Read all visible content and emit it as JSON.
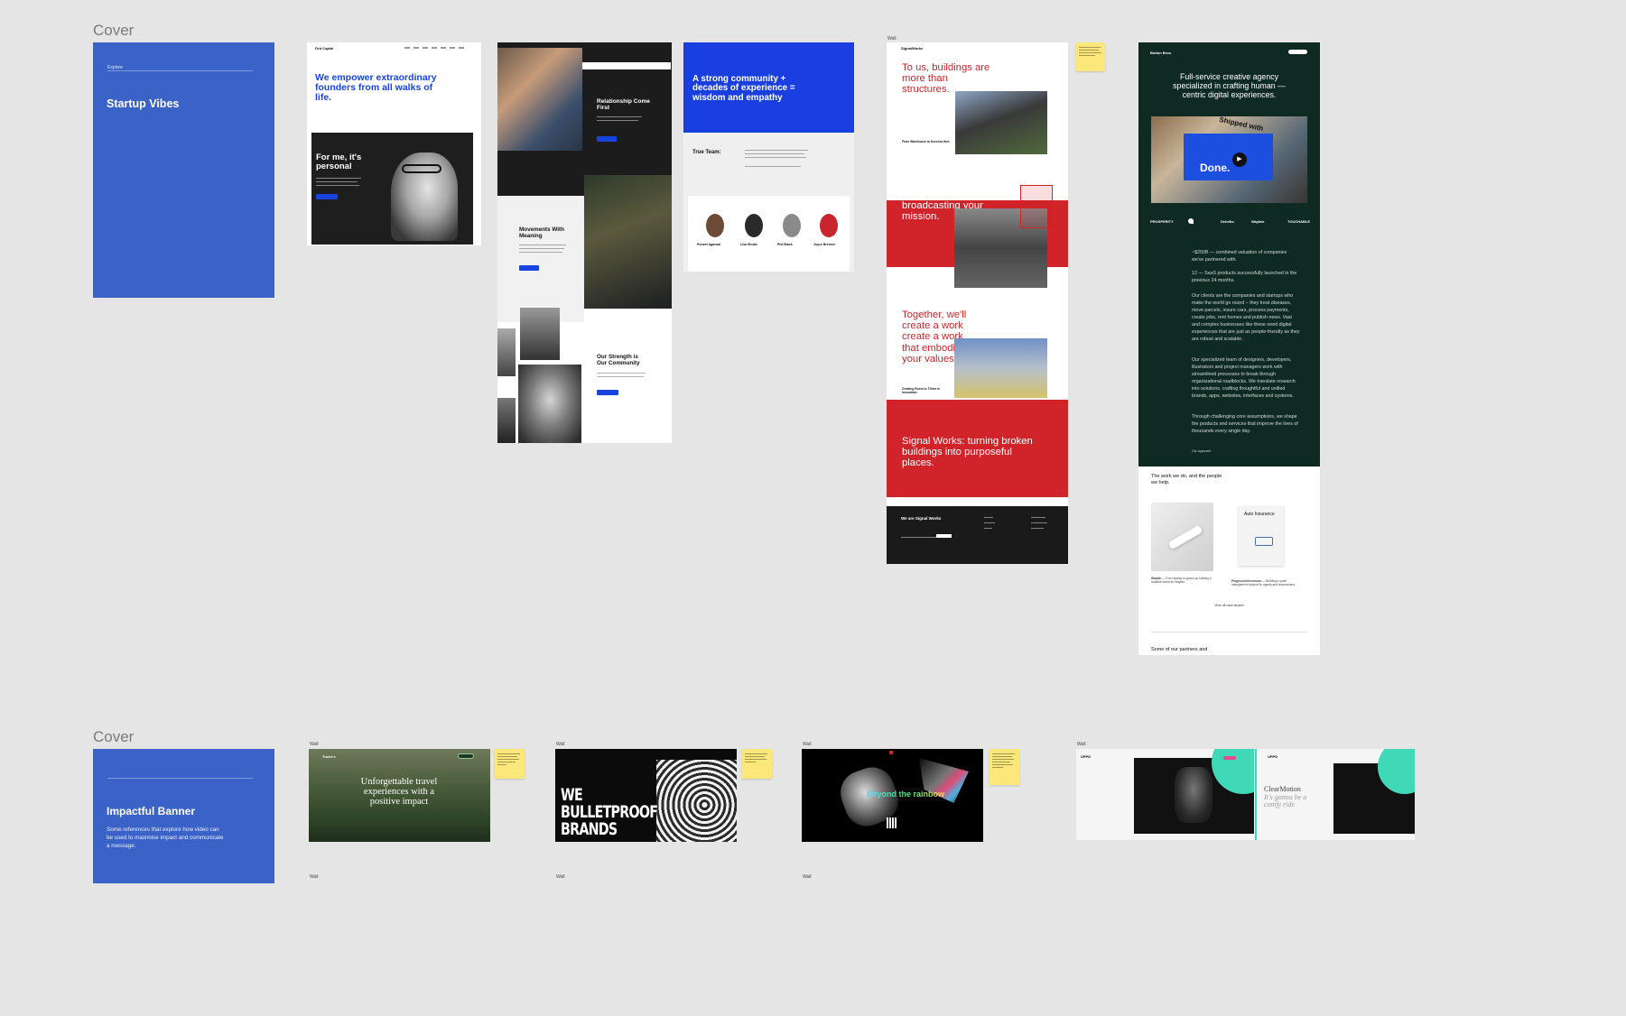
{
  "sections": [
    {
      "label": "Cover"
    },
    {
      "label": "Cover"
    }
  ],
  "covers": {
    "startup": {
      "eyebrow": "Explore",
      "title": "Startup Vibes"
    },
    "impactful": {
      "title": "Impactful Banner",
      "description": "Some references that explore how video can be used to maximise impact and communicate a message."
    }
  },
  "frame_tag": "Wall",
  "first_round": {
    "headline": "We empower extraordinary founders from all walks of life.",
    "personal": "For me, it's personal"
  },
  "collage": {
    "relationship": "Relationship Come First",
    "movements": "Movements With Meaning",
    "strength": "Our Strength is Our Community"
  },
  "community": {
    "headline": "A strong community + decades of experience = wisdom and empathy",
    "team": "True Team:",
    "people": [
      "Puneet Agarwal",
      "Lisa Shubs",
      "Phil Black",
      "Joyce Brenner"
    ]
  },
  "signal_works": {
    "logo": "SignalWorks",
    "h1": "To us, buildings are more than structures.",
    "card1": "From Warehouse to Success Hub",
    "h2": "broadcasting your mission.",
    "h3": "Together, we'll create a work create a work that embodies your values.",
    "card2": "Creating Room to Thrive in Innovation",
    "h4": "Signal Works: turning broken buildings into purposeful places.",
    "footer": "We are Signal Works"
  },
  "agency": {
    "logo": "Bolton Bros.",
    "headline": "Full-service creative agency specialized in crafting human — centric digital experiences.",
    "video_word": "Done.",
    "video_top": "Shipped with",
    "clients": [
      "PROSPERITY",
      "",
      "Deloitte.",
      "Wayfair",
      "TOUCHABLE"
    ],
    "stat1": "~$250B — combined valuation of companies we've partnered with.",
    "stat2": "12 — SaaS products successfully launched in the previous 24 months.",
    "para1": "Our clients are the companies and startups who make the world go round – they treat diseases, move parcels, insure cars, process payments, create jobs, rent homes and publish news. Vast and complex businesses like these need digital experiences that are just as people-friendly as they are robust and scalable.",
    "para2": "Our specialized team of designers, developers, illustrators and project managers work with streamlined processes to break through organizational roadblocks. We translate research into solutions, crafting thoughtful and unified brands, apps, websites, interfaces and systems.",
    "para3": "Through challenging core assumptions, we shape the products and services that improve the lives of thousands every single day.",
    "approach": "Our approach",
    "work_title": "The work we do, and the people we help.",
    "work1_label": "Wayfair",
    "work1_desc": "— From startup to grown-up building a scalable brand for Wayfair.",
    "work2_title": "Auto Insurance",
    "work2_label": "Progressiveinsurance",
    "work2_desc": "— Building a quote management system for agents and homeowners.",
    "view_all": "View all case studies",
    "partners": "Some of our partners and"
  },
  "banners": {
    "travel": "Unforgettable travel experiences with a positive impact",
    "travel_logo": "Travel e",
    "bulletproof": "WE BULLETPROOF BRANDS",
    "rainbow": "Beyond the rainbow",
    "clearmotion_logo": "UPPD",
    "clearmotion": "ClearMotion",
    "clearmotion_sub": "It's gonna be a comfy ride"
  },
  "colors": {
    "canvas": "#e5e5e5",
    "cover_blue": "#3b62c6",
    "brand_blue": "#1744e0",
    "signal_red": "#d0232a",
    "agency_green": "#0f2a22",
    "sticky_yellow": "#fbe77a"
  }
}
